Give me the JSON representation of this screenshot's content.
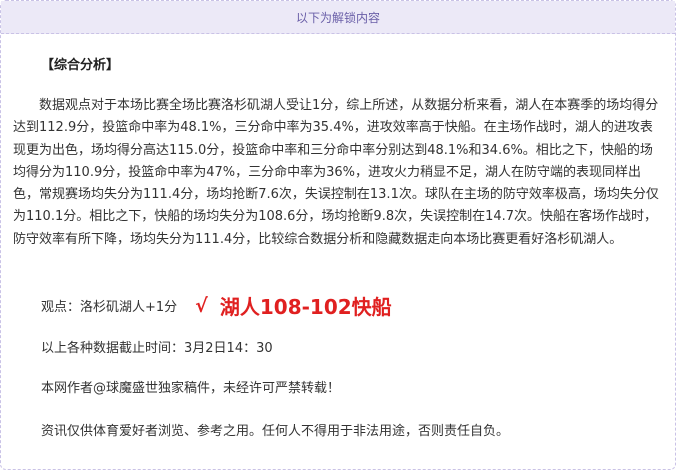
{
  "unlock_banner": "以下为解锁内容",
  "section_title": "【综合分析】",
  "paragraph": "数据观点对于本场比赛全场比赛洛杉矶湖人受让1分，综上所述，从数据分析来看，湖人在本赛季的场均得分达到112.9分，投篮命中率为48.1%，三分命中率为35.4%，进攻效率高于快船。在主场作战时，湖人的进攻表现更为出色，场均得分高达115.0分，投篮命中率和三分命中率分别达到48.1%和34.6%。相比之下，快船的场均得分为110.9分，投篮命中率为47%，三分命中率为36%，进攻火力稍显不足，湖人在防守端的表现同样出色，常规赛场均失分为111.4分，场均抢断7.6次，失误控制在13.1次。球队在主场的防守效率极高，场均失分仅为110.1分。相比之下，快船的场均失分为108.6分，场均抢断9.8次，失误控制在14.7次。快船在客场作战时，防守效率有所下降，场均失分为111.4分，比较综合数据分析和隐藏数据走向本场比赛更看好洛杉矶湖人。",
  "opinion": {
    "label": "观点：洛杉矶湖人+1分",
    "check": "√",
    "result": "湖人108-102快船"
  },
  "data_time": "以上各种数据截止时间：3月2日14：30",
  "author_note": "本网作者@球魔盛世独家稿件，未经许可严禁转载！",
  "disclaimer": "资讯仅供体育爱好者浏览、参考之用。任何人不得用于非法用途，否则责任自负。"
}
